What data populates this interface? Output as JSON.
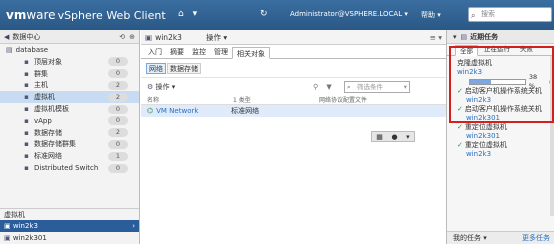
{
  "header": {
    "logo_bold": "vm",
    "logo_rest": "ware",
    "title": "vSphere Web Client",
    "home_icon": "home-icon",
    "menu_icon": "menu-icon",
    "refresh_icon": "refresh-icon",
    "user": "Administrator@VSPHERE.LOCAL",
    "help": "帮助",
    "search_placeholder": "搜索"
  },
  "navigator": {
    "back_label": "数据中心",
    "root": "database",
    "items": [
      {
        "label": "顶层对象",
        "count": "0",
        "icon": "folder-icon"
      },
      {
        "label": "群集",
        "count": "0",
        "icon": "cluster-icon"
      },
      {
        "label": "主机",
        "count": "2",
        "icon": "host-icon"
      },
      {
        "label": "虚拟机",
        "count": "2",
        "icon": "vm-icon"
      },
      {
        "label": "虚拟机模板",
        "count": "0",
        "icon": "vm-template-icon"
      },
      {
        "label": "vApp",
        "count": "0",
        "icon": "vapp-icon"
      },
      {
        "label": "数据存储",
        "count": "2",
        "icon": "datastore-icon"
      },
      {
        "label": "数据存储群集",
        "count": "0",
        "icon": "datastore-cluster-icon"
      },
      {
        "label": "标准网络",
        "count": "1",
        "icon": "network-icon"
      },
      {
        "label": "Distributed Switch",
        "count": "0",
        "icon": "switch-icon"
      }
    ],
    "selected_index": 3,
    "section_label": "虚拟机",
    "vms": [
      "win2k3",
      "win2k301"
    ]
  },
  "main": {
    "title": "win2k3",
    "actions_label": "操作",
    "tabs": [
      "入门",
      "摘要",
      "监控",
      "管理",
      "相关对象"
    ],
    "active_tab": 4,
    "subtabs": [
      "网络",
      "数据存储"
    ],
    "active_subtab": 0,
    "ops_label": "操作",
    "filter_placeholder": "筛选条件",
    "columns": [
      "名称",
      "1 类型",
      "网络协议配置文件"
    ],
    "rows": [
      {
        "name": "VM Network",
        "type": "标准网络"
      }
    ]
  },
  "tasks": {
    "header": "近期任务",
    "tabs": [
      "全部",
      "正在运行",
      "失败"
    ],
    "active_tab": 0,
    "current": {
      "title": "克隆虚拟机",
      "target": "win2k3",
      "progress_pct": 38,
      "progress_label": "38 %"
    },
    "done": [
      {
        "title": "启动客户机操作系统关机",
        "target": "win2k3"
      },
      {
        "title": "启动客户机操作系统关机",
        "target": "win2k301"
      },
      {
        "title": "重定位虚拟机",
        "target": "win2k301"
      },
      {
        "title": "重定位虚拟机",
        "target": "win2k3"
      }
    ],
    "footer": "我的任务",
    "more": "更多任务"
  }
}
